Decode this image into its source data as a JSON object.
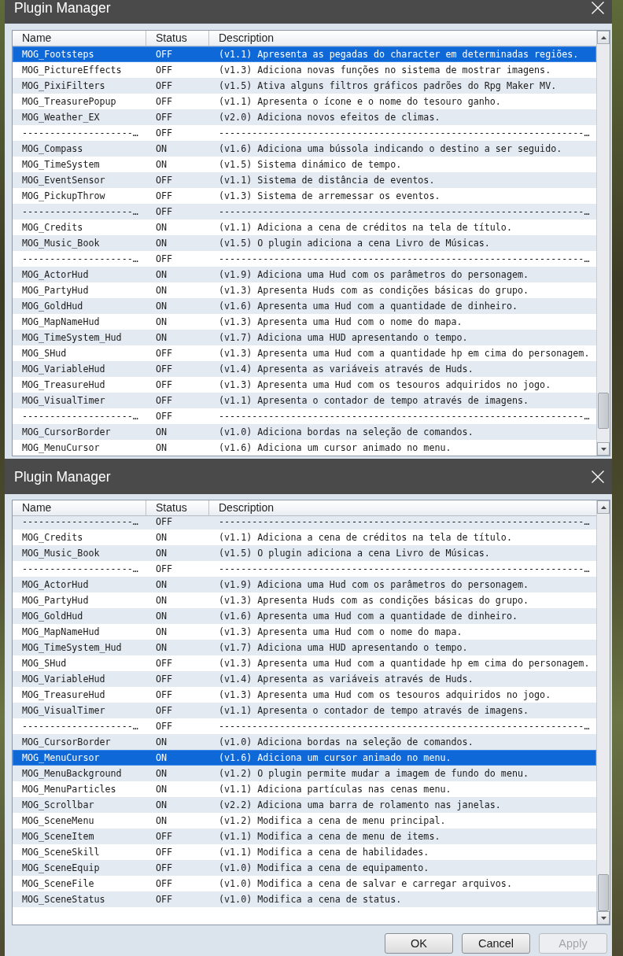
{
  "windows": [
    {
      "title": "Plugin Manager",
      "columns": [
        "Name",
        "Status",
        "Description"
      ],
      "rows": [
        {
          "name": "MOG_Footsteps",
          "status": "OFF",
          "description": "(v1.1) Apresenta as pegadas do character em determinadas regiões.",
          "selected": true
        },
        {
          "name": "MOG_PictureEffects",
          "status": "OFF",
          "description": "(v1.3) Adiciona novas funções no sistema de mostrar imagens.",
          "selected": false
        },
        {
          "name": "MOG_PixiFilters",
          "status": "OFF",
          "description": "(v1.5) Ativa alguns filtros gráficos padrões do Rpg Maker MV.",
          "selected": false
        },
        {
          "name": "MOG_TreasurePopup",
          "status": "OFF",
          "description": "(v1.1) Apresenta o ícone e o nome do tesouro ganho.",
          "selected": false
        },
        {
          "name": "MOG_Weather_EX",
          "status": "OFF",
          "description": "(v2.0) Adiciona novos efeitos de climas.",
          "selected": false
        },
        {
          "name": "--------------------…",
          "status": "OFF",
          "description": "------------------------------------------------------------------…",
          "selected": false
        },
        {
          "name": "MOG_Compass",
          "status": "ON",
          "description": "(v1.6) Adiciona uma bússola indicando o destino a ser seguido.",
          "selected": false
        },
        {
          "name": "MOG_TimeSystem",
          "status": "ON",
          "description": "(v1.5) Sistema dinámico de tempo.",
          "selected": false
        },
        {
          "name": "MOG_EventSensor",
          "status": "OFF",
          "description": "(v1.1) Sistema de distância de eventos.",
          "selected": false
        },
        {
          "name": "MOG_PickupThrow",
          "status": "OFF",
          "description": "(v1.3) Sistema de arremessar os eventos.",
          "selected": false
        },
        {
          "name": "--------------------…",
          "status": "OFF",
          "description": "------------------------------------------------------------------…",
          "selected": false
        },
        {
          "name": "MOG_Credits",
          "status": "ON",
          "description": "(v1.1) Adiciona a cena de créditos na tela de título.",
          "selected": false
        },
        {
          "name": "MOG_Music_Book",
          "status": "ON",
          "description": "(v1.5) O plugin adiciona a cena Livro de Músicas.",
          "selected": false
        },
        {
          "name": "--------------------…",
          "status": "OFF",
          "description": "------------------------------------------------------------------…",
          "selected": false
        },
        {
          "name": "MOG_ActorHud",
          "status": "ON",
          "description": "(v1.9) Adiciona uma Hud com os parâmetros do personagem.",
          "selected": false
        },
        {
          "name": "MOG_PartyHud",
          "status": "ON",
          "description": "(v1.3) Apresenta Huds com as condições básicas do grupo.",
          "selected": false
        },
        {
          "name": "MOG_GoldHud",
          "status": "ON",
          "description": "(v1.6) Apresenta uma Hud com a quantidade de dinheiro.",
          "selected": false
        },
        {
          "name": "MOG_MapNameHud",
          "status": "ON",
          "description": "(v1.3) Apresenta uma Hud com o nome do mapa.",
          "selected": false
        },
        {
          "name": "MOG_TimeSystem_Hud",
          "status": "ON",
          "description": "(v1.7) Adiciona uma HUD apresentando o tempo.",
          "selected": false
        },
        {
          "name": "MOG_SHud",
          "status": "OFF",
          "description": "(v1.3) Apresenta uma Hud com a quantidade hp em cima do personagem.",
          "selected": false
        },
        {
          "name": "MOG_VariableHud",
          "status": "OFF",
          "description": "(v1.4) Apresenta as variáveis através de Huds.",
          "selected": false
        },
        {
          "name": "MOG_TreasureHud",
          "status": "OFF",
          "description": "(v1.3) Apresenta uma Hud com os tesouros adquiridos no jogo.",
          "selected": false
        },
        {
          "name": "MOG_VisualTimer",
          "status": "OFF",
          "description": "(v1.1) Apresenta o contador de tempo através de imagens.",
          "selected": false
        },
        {
          "name": "--------------------…",
          "status": "OFF",
          "description": "------------------------------------------------------------------…",
          "selected": false
        },
        {
          "name": "MOG_CursorBorder",
          "status": "ON",
          "description": "(v1.0) Adiciona bordas na seleção de comandos.",
          "selected": false
        },
        {
          "name": "MOG_MenuCursor",
          "status": "ON",
          "description": "(v1.6) Adiciona um cursor animado no menu.",
          "selected": false
        }
      ]
    },
    {
      "title": "Plugin Manager",
      "columns": [
        "Name",
        "Status",
        "Description"
      ],
      "rows": [
        {
          "name": "--------------------…",
          "status": "OFF",
          "description": "------------------------------------------------------------------…",
          "selected": false
        },
        {
          "name": "MOG_Credits",
          "status": "ON",
          "description": "(v1.1) Adiciona a cena de créditos na tela de título.",
          "selected": false
        },
        {
          "name": "MOG_Music_Book",
          "status": "ON",
          "description": "(v1.5) O plugin adiciona a cena Livro de Músicas.",
          "selected": false
        },
        {
          "name": "--------------------…",
          "status": "OFF",
          "description": "------------------------------------------------------------------…",
          "selected": false
        },
        {
          "name": "MOG_ActorHud",
          "status": "ON",
          "description": "(v1.9) Adiciona uma Hud com os parâmetros do personagem.",
          "selected": false
        },
        {
          "name": "MOG_PartyHud",
          "status": "ON",
          "description": "(v1.3) Apresenta Huds com as condições básicas do grupo.",
          "selected": false
        },
        {
          "name": "MOG_GoldHud",
          "status": "ON",
          "description": "(v1.6) Apresenta uma Hud com a quantidade de dinheiro.",
          "selected": false
        },
        {
          "name": "MOG_MapNameHud",
          "status": "ON",
          "description": "(v1.3) Apresenta uma Hud com o nome do mapa.",
          "selected": false
        },
        {
          "name": "MOG_TimeSystem_Hud",
          "status": "ON",
          "description": "(v1.7) Adiciona uma HUD apresentando o tempo.",
          "selected": false
        },
        {
          "name": "MOG_SHud",
          "status": "OFF",
          "description": "(v1.3) Apresenta uma Hud com a quantidade hp em cima do personagem.",
          "selected": false
        },
        {
          "name": "MOG_VariableHud",
          "status": "OFF",
          "description": "(v1.4) Apresenta as variáveis através de Huds.",
          "selected": false
        },
        {
          "name": "MOG_TreasureHud",
          "status": "OFF",
          "description": "(v1.3) Apresenta uma Hud com os tesouros adquiridos no jogo.",
          "selected": false
        },
        {
          "name": "MOG_VisualTimer",
          "status": "OFF",
          "description": "(v1.1) Apresenta o contador de tempo através de imagens.",
          "selected": false
        },
        {
          "name": "--------------------…",
          "status": "OFF",
          "description": "------------------------------------------------------------------…",
          "selected": false
        },
        {
          "name": "MOG_CursorBorder",
          "status": "ON",
          "description": "(v1.0) Adiciona bordas na seleção de comandos.",
          "selected": false
        },
        {
          "name": "MOG_MenuCursor",
          "status": "ON",
          "description": "(v1.6) Adiciona um cursor animado no menu.",
          "selected": true
        },
        {
          "name": "MOG_MenuBackground",
          "status": "ON",
          "description": "(v1.2) O plugin permite mudar a imagem de fundo do menu.",
          "selected": false
        },
        {
          "name": "MOG_MenuParticles",
          "status": "ON",
          "description": "(v1.1) Adiciona partículas nas cenas menu.",
          "selected": false
        },
        {
          "name": "MOG_Scrollbar",
          "status": "ON",
          "description": "(v2.2) Adiciona uma barra de rolamento nas janelas.",
          "selected": false
        },
        {
          "name": "MOG_SceneMenu",
          "status": "ON",
          "description": "(v1.2) Modifica a cena de menu principal.",
          "selected": false
        },
        {
          "name": "MOG_SceneItem",
          "status": "OFF",
          "description": "(v1.1) Modifica a cena de menu de items.",
          "selected": false
        },
        {
          "name": "MOG_SceneSkill",
          "status": "OFF",
          "description": "(v1.1) Modifica a cena de habilidades.",
          "selected": false
        },
        {
          "name": "MOG_SceneEquip",
          "status": "OFF",
          "description": "(v1.0) Modifica a cena de equipamento.",
          "selected": false
        },
        {
          "name": "MOG_SceneFile",
          "status": "OFF",
          "description": "(v1.0) Modifica a cena de salvar e carregar arquivos.",
          "selected": false
        },
        {
          "name": "MOG_SceneStatus",
          "status": "OFF",
          "description": "(v1.0) Modifica a cena de status.",
          "selected": false
        }
      ],
      "buttons": [
        {
          "label": "OK",
          "disabled": false
        },
        {
          "label": "Cancel",
          "disabled": false
        },
        {
          "label": "Apply",
          "disabled": true
        }
      ]
    }
  ]
}
